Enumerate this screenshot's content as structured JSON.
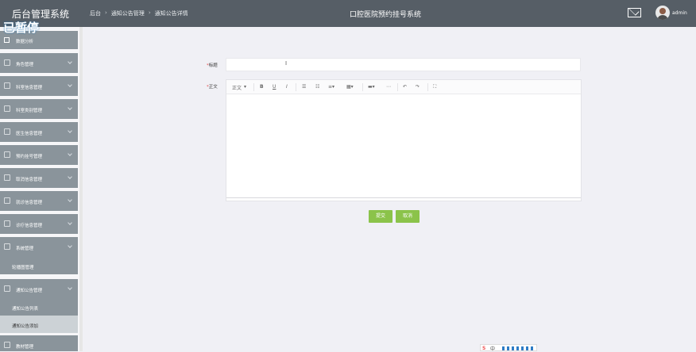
{
  "window": {
    "title": "后台管理系统",
    "status": "已暂停",
    "system_name": "口腔医院预约挂号系统",
    "user": "admin"
  },
  "breadcrumb": [
    "后台",
    "通知公告管理",
    "通知公告详情"
  ],
  "sidebar": {
    "dashboard": "数据分析",
    "items": [
      {
        "label": "角色管理",
        "icon": "role-icon"
      },
      {
        "label": "科室信息管理",
        "icon": "department-icon"
      },
      {
        "label": "科室类别管理",
        "icon": "category-icon"
      },
      {
        "label": "医生信息管理",
        "icon": "doctor-icon"
      },
      {
        "label": "预约挂号管理",
        "icon": "appointment-icon"
      },
      {
        "label": "取消信息管理",
        "icon": "cancel-icon"
      },
      {
        "label": "就诊信息管理",
        "icon": "visit-icon"
      },
      {
        "label": "诊疗信息管理",
        "icon": "treatment-icon"
      },
      {
        "label": "系统管理",
        "icon": "settings-icon"
      }
    ],
    "system_submenu": [
      "轮播图管理"
    ],
    "notice_menu": "通知公告管理",
    "notice_submenu": [
      "通知公告列表",
      "通知公告添加"
    ],
    "bottom_partial": "教材管理"
  },
  "form": {
    "title_label": "标题",
    "content_label": "正文",
    "title_value": "",
    "editor_content": ""
  },
  "toolbar": {
    "paragraph": "正文",
    "bold": "B",
    "underline": "U",
    "italic": "I"
  },
  "buttons": {
    "submit": "提交",
    "cancel": "取消"
  },
  "tray": {
    "text": "中"
  },
  "colors": {
    "topbar": "#565e66",
    "sidebar": "#8a949b",
    "button": "#8bc34a"
  }
}
